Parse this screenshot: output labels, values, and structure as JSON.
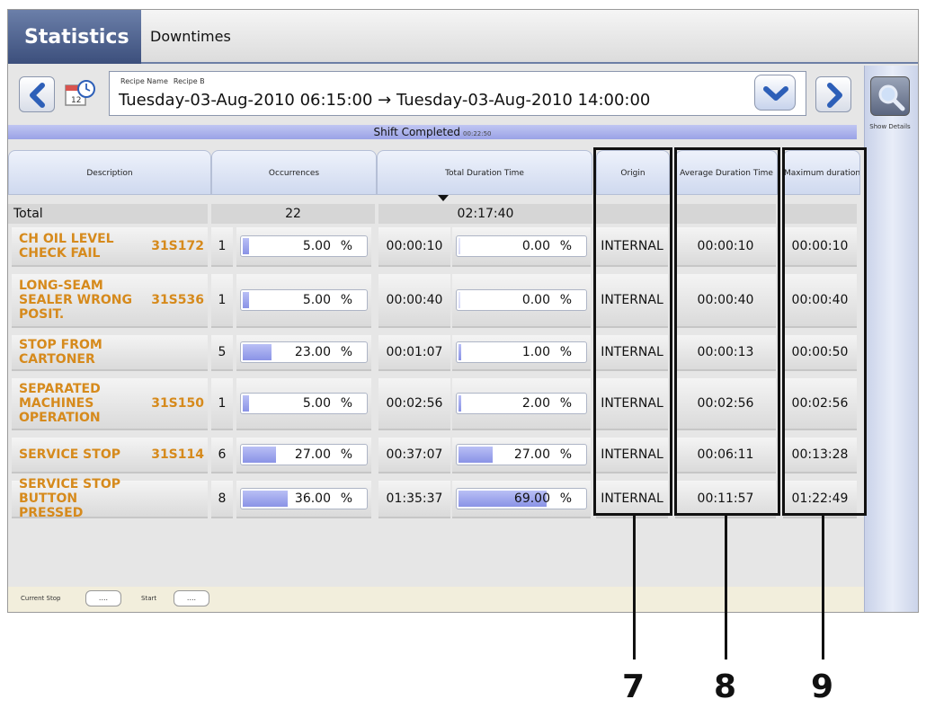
{
  "tabs": {
    "active": "Statistics",
    "other": "Downtimes"
  },
  "recipe": {
    "label": "Recipe Name",
    "value": "Recipe B"
  },
  "date_range": "Tuesday-03-Aug-2010 06:15:00 → Tuesday-03-Aug-2010 14:00:00",
  "shift": {
    "status": "Shift Completed",
    "time": "00:22:50"
  },
  "columns": {
    "description": "Description",
    "occurrences": "Occurrences",
    "total_duration": "Total Duration Time",
    "origin": "Origin",
    "avg_duration": "Average Duration Time",
    "max_duration": "Maximum duration"
  },
  "total": {
    "label": "Total",
    "occurrences": "22",
    "duration": "02:17:40"
  },
  "rows": [
    {
      "desc": "CH OIL LEVEL CHECK FAIL",
      "code": "31S172",
      "count": "1",
      "occ_pct": "5.00",
      "occ_frac": 0.05,
      "duration": "00:00:10",
      "dur_pct": "0.00",
      "dur_frac": 0.0,
      "origin": "INTERNAL",
      "avg": "00:00:10",
      "max": "00:00:10"
    },
    {
      "desc": "LONG-SEAM SEALER WRONG POSIT.",
      "code": "31S536",
      "count": "1",
      "occ_pct": "5.00",
      "occ_frac": 0.05,
      "duration": "00:00:40",
      "dur_pct": "0.00",
      "dur_frac": 0.0,
      "origin": "INTERNAL",
      "avg": "00:00:40",
      "max": "00:00:40"
    },
    {
      "desc": "STOP FROM CARTONER",
      "code": "",
      "count": "5",
      "occ_pct": "23.00",
      "occ_frac": 0.23,
      "duration": "00:01:07",
      "dur_pct": "1.00",
      "dur_frac": 0.01,
      "origin": "INTERNAL",
      "avg": "00:00:13",
      "max": "00:00:50"
    },
    {
      "desc": "SEPARATED MACHINES OPERATION",
      "code": "31S150",
      "count": "1",
      "occ_pct": "5.00",
      "occ_frac": 0.05,
      "duration": "00:02:56",
      "dur_pct": "2.00",
      "dur_frac": 0.02,
      "origin": "INTERNAL",
      "avg": "00:02:56",
      "max": "00:02:56"
    },
    {
      "desc": "SERVICE STOP",
      "code": "31S114",
      "count": "6",
      "occ_pct": "27.00",
      "occ_frac": 0.27,
      "duration": "00:37:07",
      "dur_pct": "27.00",
      "dur_frac": 0.27,
      "origin": "INTERNAL",
      "avg": "00:06:11",
      "max": "00:13:28"
    },
    {
      "desc": "SERVICE STOP BUTTON PRESSED",
      "code": "",
      "count": "8",
      "occ_pct": "36.00",
      "occ_frac": 0.36,
      "duration": "01:35:37",
      "dur_pct": "69.00",
      "dur_frac": 0.69,
      "origin": "INTERNAL",
      "avg": "00:11:57",
      "max": "01:22:49"
    }
  ],
  "pct_unit": "%",
  "footer": {
    "current_stop": "Current Stop",
    "start": "Start",
    "btn": "...."
  },
  "side": {
    "show_details": "Show Details"
  },
  "callouts": [
    "7",
    "8",
    "9"
  ]
}
